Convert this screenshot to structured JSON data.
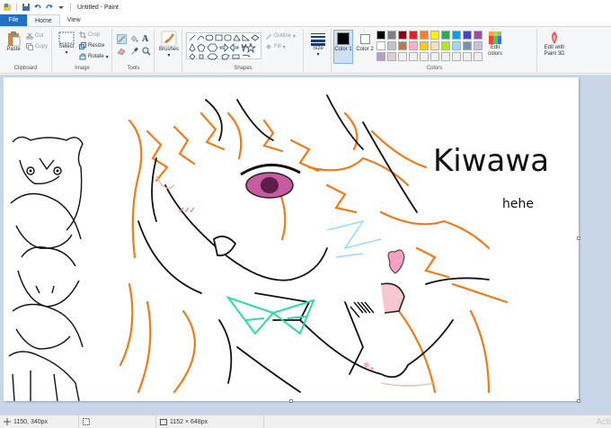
{
  "window": {
    "title": "Untitled - Paint"
  },
  "tabs": {
    "file": "File",
    "home": "Home",
    "view": "View"
  },
  "clipboard": {
    "paste": "Paste",
    "cut": "Cut",
    "copy": "Copy",
    "label": "Clipboard"
  },
  "image": {
    "select": "Select",
    "crop": "Crop",
    "resize": "Resize",
    "rotate": "Rotate",
    "label": "Image"
  },
  "tools": {
    "label": "Tools"
  },
  "brushes": {
    "label": "Brushes"
  },
  "shapes": {
    "outline": "Outline",
    "fill": "Fill",
    "label": "Shapes"
  },
  "size": {
    "label": "Size"
  },
  "colors": {
    "color1_label": "Color 1",
    "color2_label": "Color 2",
    "edit_colors": "Edit colors",
    "edit_paint3d": "Edit with Paint 3D",
    "label": "Colors",
    "color1": "#000000",
    "color2": "#ffffff",
    "palette_row1": [
      "#000000",
      "#7f7f7f",
      "#880015",
      "#ed1c24",
      "#ff7f27",
      "#fff200",
      "#22b14c",
      "#00a2e8",
      "#3f48cc",
      "#a349a4"
    ],
    "palette_row2": [
      "#ffffff",
      "#c3c3c3",
      "#b97a57",
      "#ffaec9",
      "#ffc90e",
      "#efe4b0",
      "#b5e61d",
      "#99d9ea",
      "#7092be",
      "#c8bfe7"
    ],
    "palette_row3": [
      "#b4a0c8",
      "#dccfd6",
      "#f0f0f0",
      "#f0f0f0",
      "#f0f0f0",
      "#f0f0f0",
      "#f0f0f0",
      "#f0f0f0",
      "#f0f0f0",
      "#f0f0f0"
    ]
  },
  "drawing": {
    "text1": "Kiwawa",
    "text2": "hehe"
  },
  "status": {
    "cursor": "1150, 340px",
    "image_size": "1152 × 648px",
    "watermark": "Acti"
  }
}
